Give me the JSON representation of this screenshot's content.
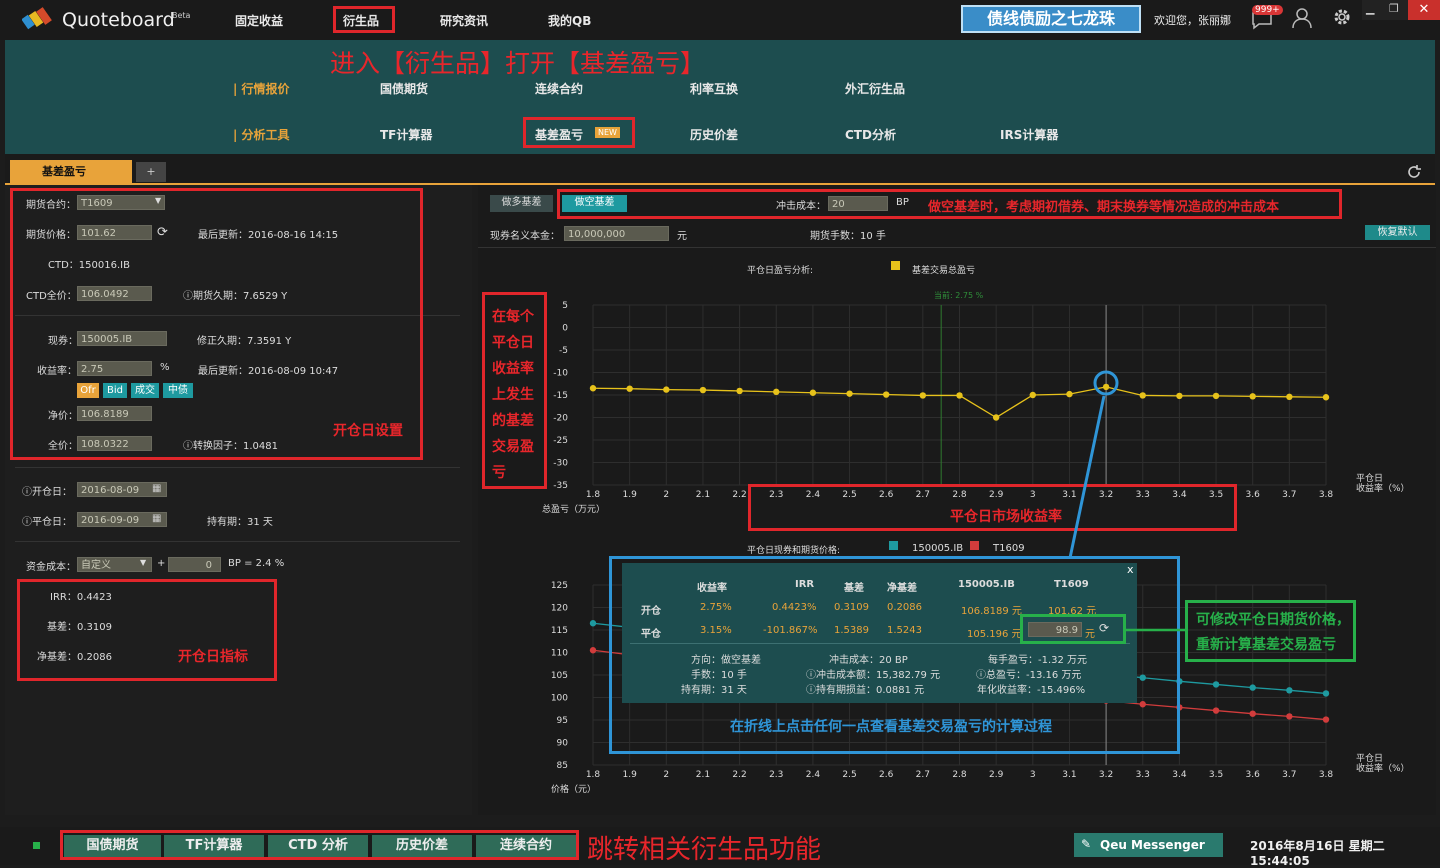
{
  "app": {
    "name": "Quoteboard",
    "beta": "Beta"
  },
  "topnav": {
    "items": [
      "固定收益",
      "衍生品",
      "研究资讯",
      "我的QB"
    ],
    "banner": "债线债励之七龙珠",
    "welcome": "欢迎您，张丽娜",
    "badge": "999+"
  },
  "subnav": {
    "row1_label": "| 行情报价",
    "row1": [
      "国债期货",
      "连续合约",
      "利率互换",
      "外汇衍生品"
    ],
    "row2_label": "| 分析工具",
    "row2": [
      "TF计算器",
      "基差盈亏",
      "历史价差",
      "CTD分析",
      "IRS计算器"
    ],
    "new_badge": "NEW"
  },
  "annotations": {
    "enter": "进入【衍生品】打开【基差盈亏】",
    "short_cost": "做空基差时，考虑期初借券、期末换券等情况造成的冲击成本",
    "vertical": [
      "在每个",
      "平仓日",
      "收益率",
      "上发生",
      "的基差",
      "交易盈",
      "亏"
    ],
    "open_settings": "开仓日设置",
    "market_yield": "平仓日市场收益率",
    "open_indicators": "开仓日指标",
    "modify": [
      "可修改平仓日期货价格，",
      "重新计算基差交易盈亏"
    ],
    "click_hint": "在折线上点击任何一点查看基差交易盈亏的计算过程",
    "jump": "跳转相关衍生品功能"
  },
  "tab": {
    "label": "基差盈亏",
    "add": "+"
  },
  "left": {
    "fut_contract_label": "期货合约：",
    "fut_contract": "T1609",
    "fut_price_label": "期货价格：",
    "fut_price": "101.62",
    "last_update_label": "最后更新：",
    "last_update": "2016-08-16 14:15",
    "ctd_label": "CTD：",
    "ctd": "150016.IB",
    "ctd_price_label": "CTD全价：",
    "ctd_price": "106.0492",
    "fut_dur_label": "期货久期：",
    "fut_dur": "7.6529 Y",
    "spot_label": "现券：",
    "spot": "150005.IB",
    "mod_dur_label": "修正久期：",
    "mod_dur": "7.3591 Y",
    "yield_label": "收益率：",
    "yield": "2.75",
    "pct": "%",
    "last_update2_label": "最后更新：",
    "last_update2": "2016-08-09 10:47",
    "yield_btns": [
      "Ofr",
      "Bid",
      "成交",
      "中债"
    ],
    "net_label": "净价：",
    "net": "106.8189",
    "full_label": "全价：",
    "full": "108.0322",
    "conv_label": "转换因子：",
    "conv": "1.0481",
    "open_date_label": "开仓日：",
    "open_date": "2016-08-09",
    "close_date_label": "平仓日：",
    "close_date": "2016-09-09",
    "hold_label": "持有期：",
    "hold": "31 天",
    "fund_label": "资金成本：",
    "fund": "自定义",
    "plus": "+",
    "fund_bp": "0",
    "fund_eq": "BP = 2.4 %",
    "irr_label": "IRR：",
    "irr": "0.4423",
    "basis_label": "基差：",
    "basis": "0.3109",
    "netbasis_label": "净基差：",
    "netbasis": "0.2086"
  },
  "right": {
    "long_btn": "做多基差",
    "short_btn": "做空基差",
    "impact_label": "冲击成本：",
    "impact": "20",
    "bp": "BP",
    "notional_label": "现券名义本金：",
    "notional": "10,000,000",
    "yuan": "元",
    "hands_label": "期货手数：",
    "hands": "10 手",
    "reset": "恢复默认"
  },
  "chart_data": [
    {
      "type": "line",
      "title": "平仓日盈亏分析:",
      "legend": [
        "基差交易总盈亏"
      ],
      "xlabel": "平仓日\n收益率（%）",
      "ylabel": "总盈亏（万元）",
      "x": [
        1.8,
        1.9,
        2,
        2.1,
        2.2,
        2.3,
        2.4,
        2.5,
        2.6,
        2.7,
        2.8,
        2.9,
        3,
        3.1,
        3.2,
        3.3,
        3.4,
        3.5,
        3.6,
        3.7,
        3.8
      ],
      "series": [
        {
          "name": "基差交易总盈亏",
          "color": "#e7c21b",
          "values": [
            -13.5,
            -13.6,
            -13.8,
            -13.9,
            -14.1,
            -14.3,
            -14.5,
            -14.7,
            -14.9,
            -15.1,
            -15.1,
            -20,
            -15.0,
            -14.8,
            -13.2,
            -15.1,
            -15.2,
            -15.2,
            -15.3,
            -15.4,
            -15.5
          ]
        }
      ],
      "current_label": "当前: 2.75 %",
      "current_x": 2.75,
      "ylim": [
        -35,
        5
      ],
      "yticks": [
        5,
        0,
        -5,
        -10,
        -15,
        -20,
        -25,
        -30,
        -35
      ]
    },
    {
      "type": "line",
      "title": "平仓日现券和期货价格:",
      "legend": [
        "150005.IB",
        "T1609"
      ],
      "xlabel": "平仓日\n收益率（%）",
      "ylabel": "价格（元）",
      "x": [
        1.8,
        1.9,
        2,
        2.1,
        2.2,
        2.3,
        2.4,
        2.5,
        2.6,
        2.7,
        2.8,
        2.9,
        3,
        3.1,
        3.2,
        3.3,
        3.4,
        3.5,
        3.6,
        3.7,
        3.8
      ],
      "series": [
        {
          "name": "150005.IB",
          "color": "#1e9aa0",
          "values": [
            116.5,
            115.6,
            114.7,
            113.8,
            113.0,
            112.1,
            111.3,
            110.4,
            109.6,
            108.8,
            108.0,
            107.3,
            106.5,
            105.8,
            105.2,
            104.4,
            103.6,
            102.9,
            102.2,
            101.6,
            100.9
          ]
        },
        {
          "name": "T1609",
          "color": "#d23c3c",
          "values": [
            110.5,
            109.5,
            108.6,
            107.8,
            106.9,
            106.0,
            105.2,
            104.4,
            103.6,
            102.9,
            102.1,
            101.4,
            100.7,
            99.9,
            99.3,
            98.5,
            97.8,
            97.1,
            96.4,
            95.8,
            95.1
          ]
        }
      ],
      "ylim": [
        85,
        125
      ],
      "yticks": [
        125,
        120,
        115,
        110,
        105,
        100,
        95,
        90,
        85
      ]
    }
  ],
  "tooltip": {
    "close": "x",
    "headers": [
      "收益率",
      "IRR",
      "基差",
      "净基差",
      "150005.IB",
      "T1609"
    ],
    "rows": [
      {
        "label": "开仓",
        "cells": [
          "2.75%",
          "0.4423%",
          "0.3109",
          "0.2086",
          "106.8189 元",
          "101.62 元"
        ]
      },
      {
        "label": "平仓",
        "cells": [
          "3.15%",
          "-101.867%",
          "1.5389",
          "1.5243",
          "105.196 元",
          "98.9"
        ],
        "unit": "元"
      }
    ],
    "details": [
      [
        "方向：做空基差",
        "冲击成本：20 BP",
        "每手盈亏：-1.32 万元"
      ],
      [
        "手数：10 手",
        "冲击成本额：15,382.79 元",
        "总盈亏：-13.16 万元"
      ],
      [
        "持有期：31 天",
        "持有期损益：0.0881 元",
        "年化收益率：-15.496%"
      ]
    ]
  },
  "footer": {
    "buttons": [
      "国债期货",
      "TF计算器",
      "CTD 分析",
      "历史价差",
      "连续合约"
    ],
    "messenger": "Qeu Messenger",
    "datetime": "2016年8月16日 星期二 15:44:05"
  }
}
